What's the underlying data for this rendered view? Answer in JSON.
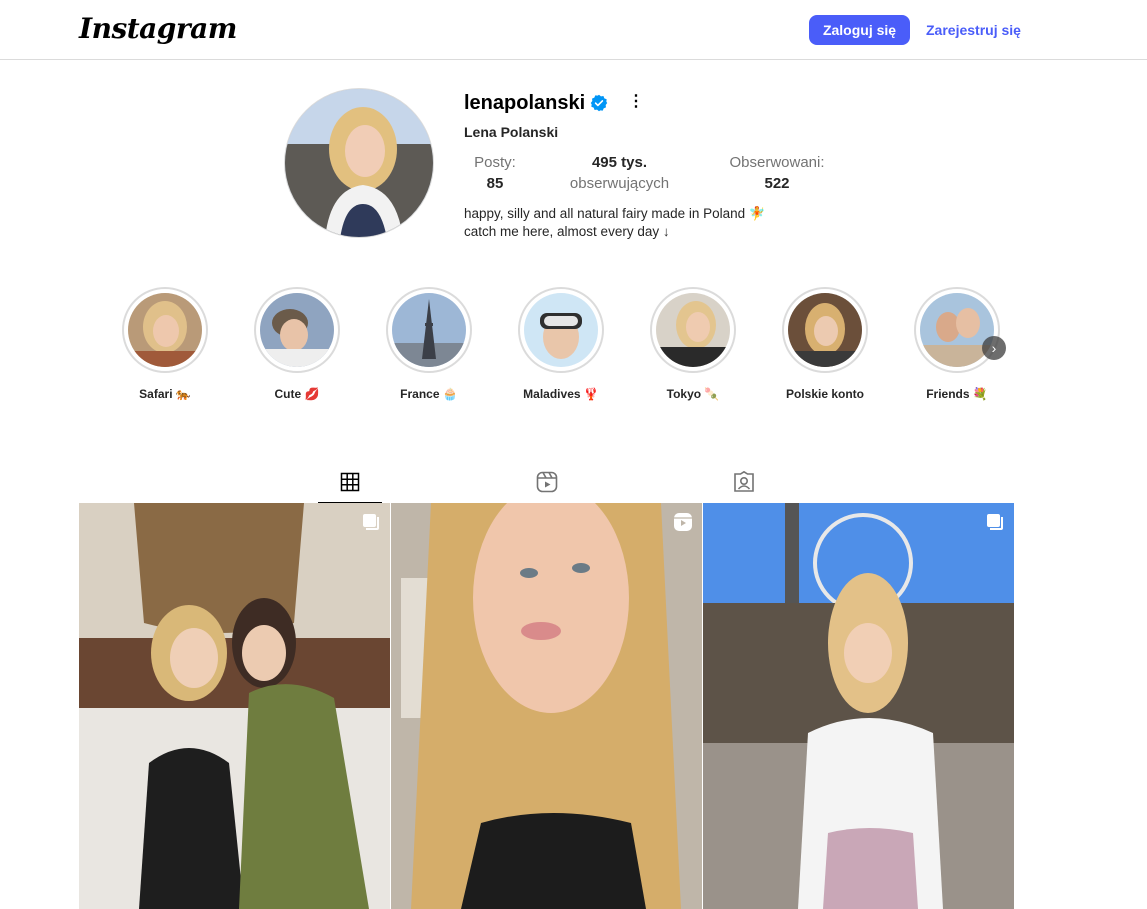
{
  "header": {
    "logo": "Instagram",
    "login_label": "Zaloguj się",
    "signup_label": "Zarejestruj się"
  },
  "profile": {
    "username": "lenapolanski",
    "full_name": "Lena Polanski",
    "verified": true,
    "stats": {
      "posts_label": "Posty:",
      "posts_value": "85",
      "followers_value": "495 tys.",
      "followers_label": "obserwujących",
      "following_label": "Obserwowani:",
      "following_value": "522"
    },
    "bio": {
      "line1": "happy, silly and all natural fairy made in Poland 🧚",
      "line2": "catch me here, almost every day ↓"
    }
  },
  "highlights": [
    {
      "label": "Safari 🐅"
    },
    {
      "label": "Cute 💋"
    },
    {
      "label": "France 🧁"
    },
    {
      "label": "Maladives 🦞"
    },
    {
      "label": "Tokyo 🍡"
    },
    {
      "label": "Polskie konto"
    },
    {
      "label": "Friends 💐"
    }
  ],
  "tabs": [
    "posts-grid-icon",
    "reels-icon",
    "tagged-icon"
  ],
  "colors": {
    "accent": "#4a5df9",
    "verified": "#0095f6",
    "border": "#dbdbdb",
    "muted": "#737373"
  }
}
